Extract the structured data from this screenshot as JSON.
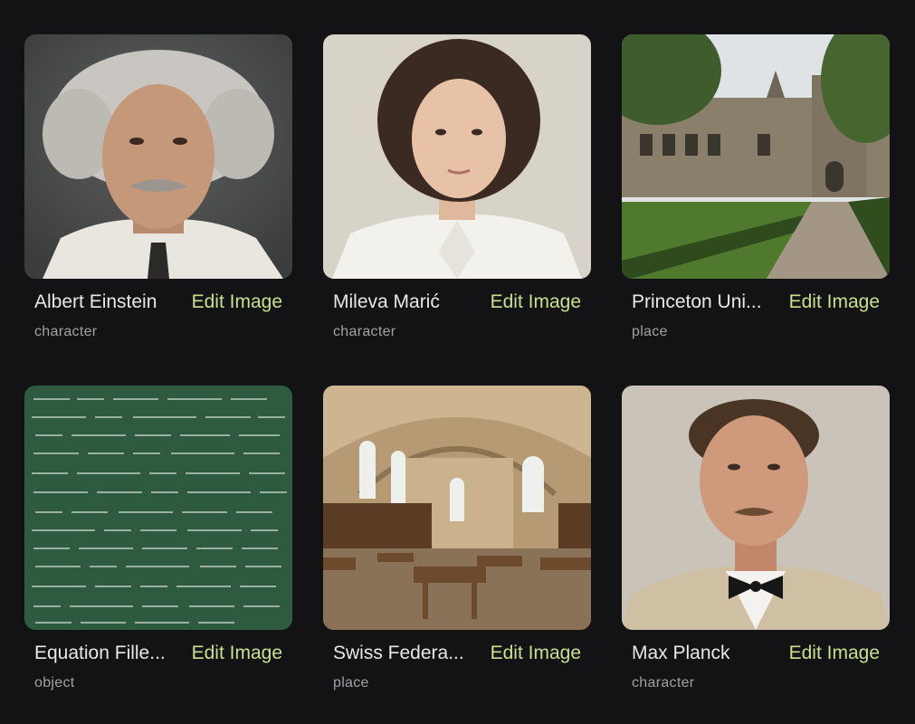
{
  "cards": [
    {
      "title": "Albert Einstein",
      "action": "Edit Image",
      "type": "character",
      "image": "portrait-elderly-man-wild-white-hair"
    },
    {
      "title": "Mileva Marić",
      "action": "Edit Image",
      "type": "character",
      "image": "portrait-young-woman-dark-hair"
    },
    {
      "title": "Princeton Uni...",
      "action": "Edit Image",
      "type": "place",
      "image": "stone-university-building-courtyard"
    },
    {
      "title": "Equation Fille...",
      "action": "Edit Image",
      "type": "object",
      "image": "green-chalkboard-equations"
    },
    {
      "title": "Swiss Federa...",
      "action": "Edit Image",
      "type": "place",
      "image": "vaulted-library-hall"
    },
    {
      "title": "Max Planck",
      "action": "Edit Image",
      "type": "character",
      "image": "portrait-man-mustache-bow-tie"
    }
  ],
  "colors": {
    "background": "#131316",
    "title": "#e8e8ea",
    "accent": "#c9e08c",
    "subtitle": "#a1a1a6"
  }
}
